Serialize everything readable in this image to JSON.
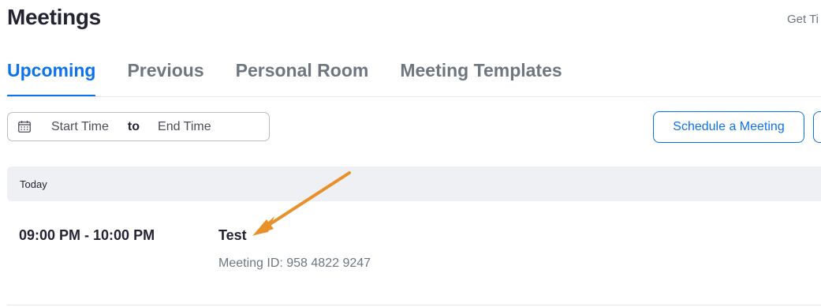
{
  "header": {
    "title": "Meetings",
    "top_link": "Get Ti"
  },
  "tabs": [
    {
      "label": "Upcoming",
      "active": true
    },
    {
      "label": "Previous",
      "active": false
    },
    {
      "label": "Personal Room",
      "active": false
    },
    {
      "label": "Meeting Templates",
      "active": false
    }
  ],
  "filter": {
    "start_placeholder": "Start Time",
    "to_label": "to",
    "end_placeholder": "End Time",
    "icon": "calendar-icon"
  },
  "actions": {
    "schedule_label": "Schedule a Meeting"
  },
  "meetings": {
    "day_label": "Today",
    "items": [
      {
        "time": "09:00 PM - 10:00 PM",
        "topic": "Test",
        "meeting_id": "Meeting ID: 958 4822 9247"
      }
    ]
  },
  "colors": {
    "accent": "#0e72ed",
    "annotation_arrow": "#e8912a",
    "day_header_bg": "#eef0f3"
  }
}
